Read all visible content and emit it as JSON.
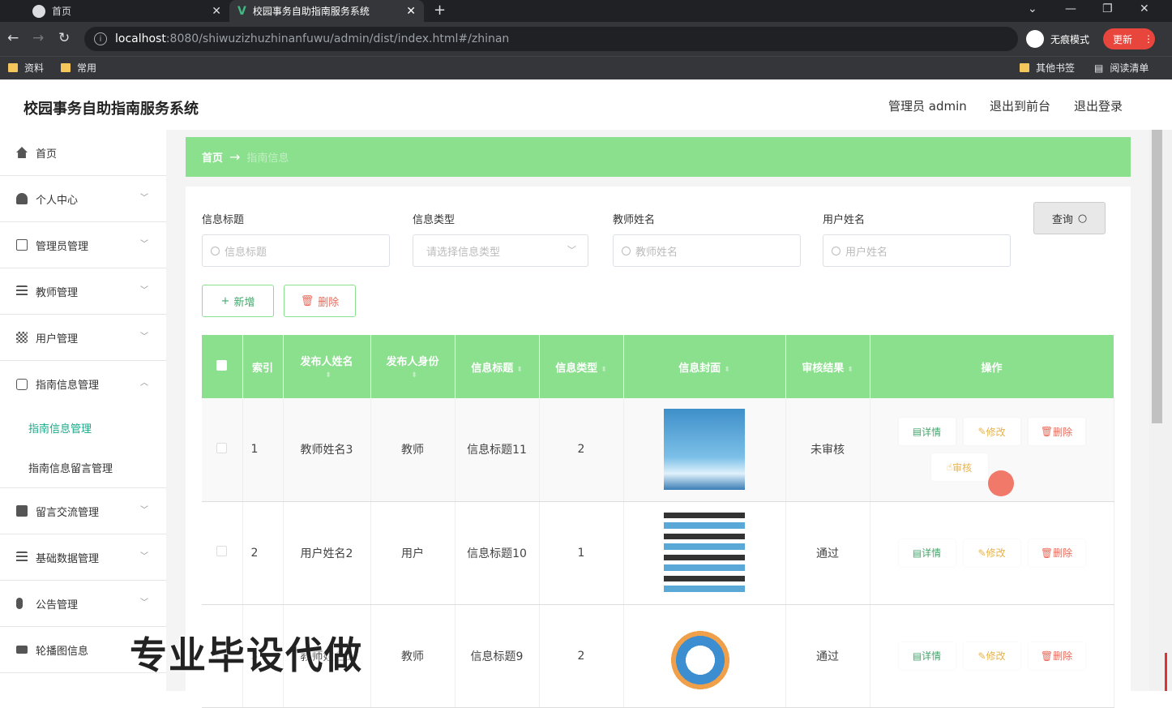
{
  "browser": {
    "tabs": [
      {
        "title": "首页"
      },
      {
        "title": "校园事务自助指南服务系统"
      }
    ],
    "url_host": "localhost",
    "url_path": ":8080/shiwuzizhuzhinanfuwu/admin/dist/index.html#/zhinan",
    "incognito_label": "无痕模式",
    "update_label": "更新",
    "bookmarks": [
      "资料",
      "常用"
    ],
    "bookmarks_right": [
      "其他书签",
      "阅读清单"
    ]
  },
  "header": {
    "title": "校园事务自助指南服务系统",
    "user": "管理员 admin",
    "to_front": "退出到前台",
    "logout": "退出登录"
  },
  "sidebar": {
    "items": [
      {
        "label": "首页"
      },
      {
        "label": "个人中心"
      },
      {
        "label": "管理员管理"
      },
      {
        "label": "教师管理"
      },
      {
        "label": "用户管理"
      },
      {
        "label": "指南信息管理"
      },
      {
        "label": "留言交流管理"
      },
      {
        "label": "基础数据管理"
      },
      {
        "label": "公告管理"
      },
      {
        "label": "轮播图信息"
      }
    ],
    "subitems": [
      "指南信息管理",
      "指南信息留言管理"
    ]
  },
  "breadcrumb": {
    "home": "首页",
    "current": "指南信息"
  },
  "filters": {
    "title_label": "信息标题",
    "title_placeholder": "信息标题",
    "type_label": "信息类型",
    "type_placeholder": "请选择信息类型",
    "teacher_label": "教师姓名",
    "teacher_placeholder": "教师姓名",
    "user_label": "用户姓名",
    "user_placeholder": "用户姓名",
    "query": "查询"
  },
  "actions": {
    "add": "新增",
    "delete": "删除"
  },
  "table": {
    "headers": [
      "索引",
      "发布人姓名",
      "发布人身份",
      "信息标题",
      "信息类型",
      "信息封面",
      "审核结果",
      "操作"
    ],
    "rows": [
      {
        "index": "1",
        "name": "教师姓名3",
        "role": "教师",
        "title": "信息标题11",
        "type": "2",
        "result": "未审核"
      },
      {
        "index": "2",
        "name": "用户姓名2",
        "role": "用户",
        "title": "信息标题10",
        "type": "1",
        "result": "通过"
      },
      {
        "index": "3",
        "name": "教师姓名1",
        "role": "教师",
        "title": "信息标题9",
        "type": "2",
        "result": "通过"
      }
    ],
    "ops": {
      "detail": "详情",
      "edit": "修改",
      "delete": "删除",
      "audit": "审核"
    }
  },
  "watermark": "专业毕设代做"
}
